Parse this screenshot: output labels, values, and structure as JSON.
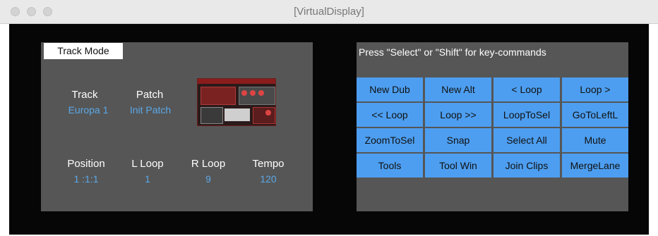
{
  "window": {
    "title": "[VirtualDisplay]"
  },
  "track_panel": {
    "mode_label": "Track Mode",
    "track": {
      "label": "Track",
      "value": "Europa 1"
    },
    "patch": {
      "label": "Patch",
      "value": "Init Patch"
    },
    "position": {
      "label": "Position",
      "value": "1  :1:1"
    },
    "l_loop": {
      "label": "L Loop",
      "value": "1"
    },
    "r_loop": {
      "label": "R Loop",
      "value": "9"
    },
    "tempo": {
      "label": "Tempo",
      "value": "120"
    }
  },
  "command_panel": {
    "hint": "Press \"Select\" or \"Shift\" for key-commands",
    "buttons": [
      "New Dub",
      "New Alt",
      "< Loop",
      "Loop >",
      "<< Loop",
      "Loop >>",
      "LoopToSel",
      "GoToLeftL",
      "ZoomToSel",
      "Snap",
      "Select All",
      "Mute",
      "Tools",
      "Tool Win",
      "Join Clips",
      "MergeLane"
    ]
  },
  "colors": {
    "panel": "#565656",
    "button": "#4d9ef0",
    "value_text": "#5aa8e8",
    "display_bg": "#060606"
  }
}
